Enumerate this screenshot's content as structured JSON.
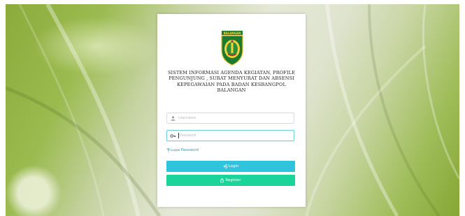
{
  "login_form": {
    "title": "SISTEM INFORMASI AGENDA KEGIATAN, PROFILE PENGUNJUNG , SURAT MENYURAT DAN ABSENSI KEPEGAWAIAN PADA BADAN KESBANGPOL BALANGAN",
    "logo_text": "BALANGAN",
    "username_placeholder": "Username",
    "password_placeholder": "Password",
    "forgot_password_label": "Lupa Password",
    "login_label": "Login",
    "register_label": "Register"
  },
  "colors": {
    "accent_link": "#1aa3b8",
    "login_button": "#2fc4dc",
    "register_button": "#1bd49a",
    "focus_border": "#6fd3dc",
    "background_green": "#8cab3c"
  },
  "icons": {
    "username": "user-icon",
    "password": "key-icon",
    "forgot": "question-icon",
    "login": "sign-in-icon",
    "register": "lock-icon"
  }
}
